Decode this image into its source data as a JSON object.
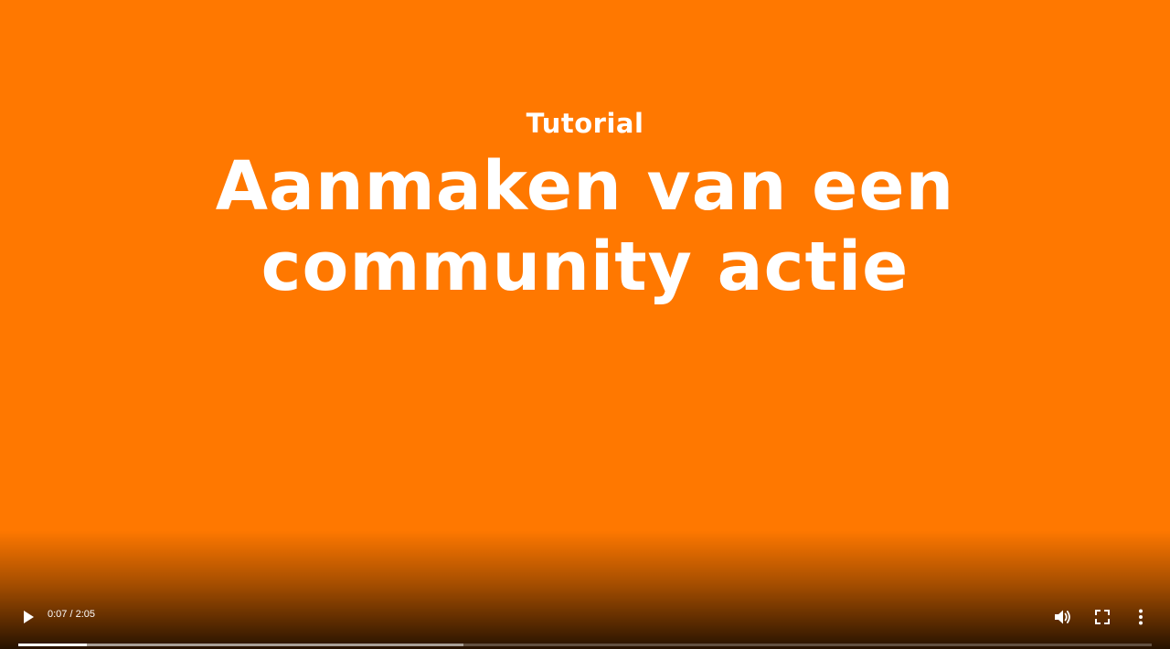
{
  "slide": {
    "kicker": "Tutorial",
    "title_line1": "Aanmaken van een",
    "title_line2": "community actie"
  },
  "player": {
    "current_time": "0:07",
    "duration": "2:05",
    "time_display": "0:07 / 2:05",
    "progress_played_fraction": 0.0607,
    "progress_buffered_fraction": 0.3927,
    "icons": {
      "play": "play-icon",
      "volume": "volume-icon",
      "fullscreen": "fullscreen-icon",
      "more": "more-options-icon"
    }
  },
  "colors": {
    "background": "#FF7800",
    "text": "#FFFFFF"
  }
}
